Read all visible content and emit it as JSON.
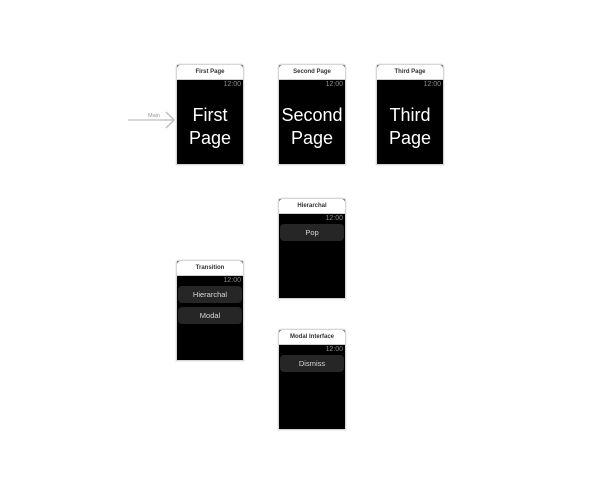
{
  "storyboard": {
    "entry_point": {
      "label": "Main",
      "icon": "arrow-right-icon"
    },
    "clock_text": "12:00",
    "scenes": {
      "first_page": {
        "title": "First Page",
        "content_lines": [
          "First",
          "Page"
        ]
      },
      "second_page": {
        "title": "Second Page",
        "content_lines": [
          "Second",
          "Page"
        ]
      },
      "third_page": {
        "title": "Third Page",
        "content_lines": [
          "Third",
          "Page"
        ]
      },
      "hierarchal": {
        "title": "Hierarchal",
        "buttons": [
          "Pop"
        ]
      },
      "transition": {
        "title": "Transition",
        "buttons": [
          "Hierarchal",
          "Modal"
        ]
      },
      "modal_interface": {
        "title": "Modal Interface",
        "buttons": [
          "Dismiss"
        ]
      }
    }
  }
}
